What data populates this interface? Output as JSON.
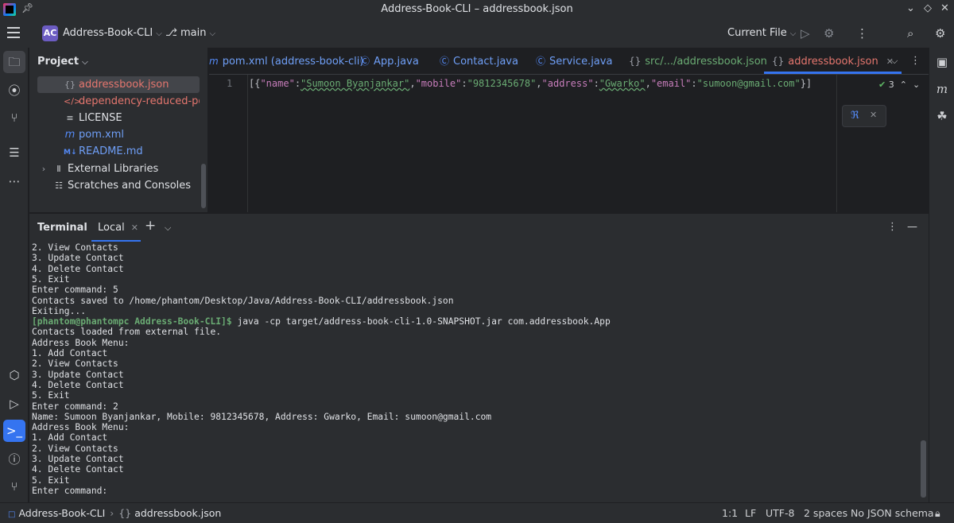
{
  "window": {
    "title": "Address-Book-CLI – addressbook.json"
  },
  "toolbar": {
    "project_badge": "AC",
    "project_name": "Address-Book-CLI",
    "branch": "main",
    "run_config": "Current File"
  },
  "project_panel": {
    "header": "Project",
    "items": [
      {
        "label": "addressbook.json",
        "icon": "json-braces-icon",
        "selected": true
      },
      {
        "label": "dependency-reduced-pom.xml",
        "icon": "xml-icon"
      },
      {
        "label": "LICENSE",
        "icon": "text-file-icon"
      },
      {
        "label": "pom.xml",
        "icon": "maven-icon"
      },
      {
        "label": "README.md",
        "icon": "markdown-icon"
      },
      {
        "label": "External Libraries",
        "icon": "library-icon"
      },
      {
        "label": "Scratches and Consoles",
        "icon": "scratches-icon"
      }
    ]
  },
  "tabs": [
    {
      "label": "pom.xml (address-book-cli)",
      "icon": "maven-icon"
    },
    {
      "label": "App.java",
      "icon": "class-icon"
    },
    {
      "label": "Contact.java",
      "icon": "class-icon"
    },
    {
      "label": "Service.java",
      "icon": "class-icon"
    },
    {
      "label": "src/.../addressbook.json",
      "icon": "json-braces-icon"
    },
    {
      "label": "addressbook.json",
      "icon": "json-braces-icon",
      "active": true
    }
  ],
  "editor": {
    "line_number": "1",
    "code": {
      "open": "[{",
      "k1": "\"name\"",
      "v1": "\"Sumoon Byanjankar\"",
      "k2": "\"mobile\"",
      "v2": "\"9812345678\"",
      "k3": "\"address\"",
      "v3": "\"Gwarko\"",
      "k4": "\"email\"",
      "v4": "\"sumoon@gmail.com\"",
      "close": "}]"
    },
    "inspection_count": "3"
  },
  "terminal": {
    "title": "Terminal",
    "tab": "Local",
    "prompt": "[phantom@phantompc Address-Book-CLI]$",
    "command": " java -cp target/address-book-cli-1.0-SNAPSHOT.jar com.addressbook.App",
    "lines_before": [
      "2. View Contacts",
      "3. Update Contact",
      "4. Delete Contact",
      "5. Exit",
      "Enter command: 5",
      "Contacts saved to /home/phantom/Desktop/Java/Address-Book-CLI/addressbook.json",
      "Exiting..."
    ],
    "lines_after": [
      "Contacts loaded from external file.",
      "Address Book Menu:",
      "1. Add Contact",
      "2. View Contacts",
      "3. Update Contact",
      "4. Delete Contact",
      "5. Exit",
      "Enter command: 2",
      "Name: Sumoon Byanjankar, Mobile: 9812345678, Address: Gwarko, Email: sumoon@gmail.com",
      "Address Book Menu:",
      "1. Add Contact",
      "2. View Contacts",
      "3. Update Contact",
      "4. Delete Contact",
      "5. Exit",
      "Enter command:"
    ]
  },
  "statusbar": {
    "crumb_project": "Address-Book-CLI",
    "crumb_file": "addressbook.json",
    "position": "1:1",
    "line_sep": "LF",
    "encoding": "UTF-8",
    "indent": "2 spaces",
    "schema": "No JSON schema"
  },
  "colors": {
    "accent": "#3574f0",
    "background": "#1e1f22",
    "panel": "#2b2d30",
    "json_key": "#c77dbb",
    "json_string": "#6aab73"
  }
}
